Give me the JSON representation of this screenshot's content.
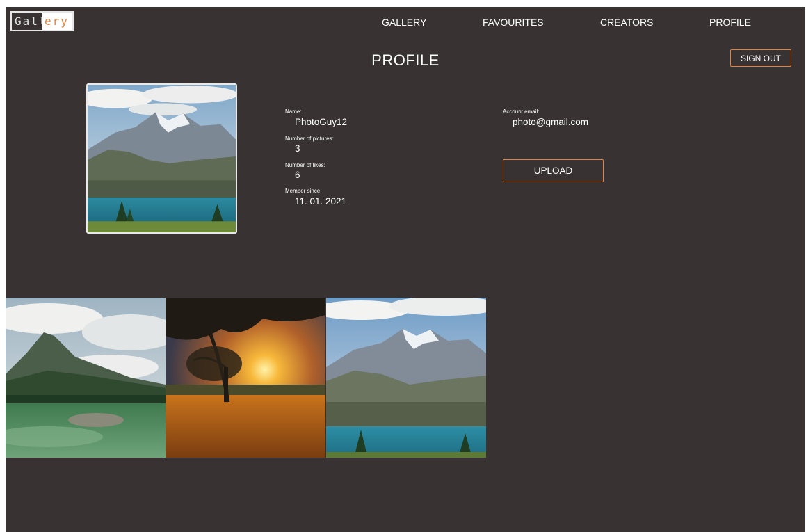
{
  "logo": {
    "part1": "Gall",
    "part2": "ery"
  },
  "nav": {
    "gallery": "GALLERY",
    "favourites": "FAVOURITES",
    "creators": "CREATORS",
    "profile": "PROFILE"
  },
  "page": {
    "title": "PROFILE",
    "sign_out": "SIGN OUT"
  },
  "profile": {
    "name_label": "Name:",
    "name": "PhotoGuy12",
    "pictures_label": "Number of pictures:",
    "pictures": "3",
    "likes_label": "Number of likes:",
    "likes": "6",
    "since_label": "Member since:",
    "since": "11. 01. 2021",
    "email_label": "Account email:",
    "email": "photo@gmail.com",
    "upload": "UPLOAD"
  },
  "gallery": {
    "photos": [
      {
        "subject": "mountain-lake-clear-water"
      },
      {
        "subject": "sunset-tree-meadow"
      },
      {
        "subject": "mountain-lake-turquoise"
      }
    ]
  },
  "colors": {
    "background": "#383332",
    "accent": "#e8823a",
    "text": "#ffffff"
  }
}
